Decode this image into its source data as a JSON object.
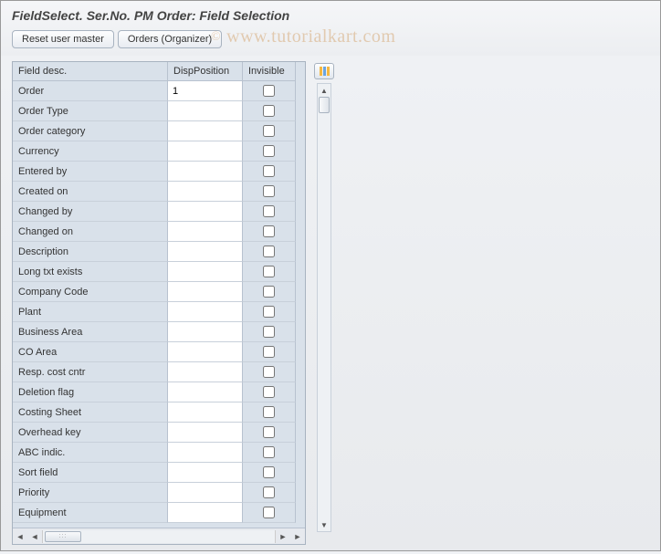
{
  "header": {
    "title": "FieldSelect. Ser.No. PM Order: Field Selection"
  },
  "toolbar": {
    "reset_label": "Reset user master",
    "orders_label": "Orders (Organizer)"
  },
  "table": {
    "columns": {
      "field_desc": "Field desc.",
      "disp_position": "DispPosition",
      "invisible": "Invisible"
    },
    "rows": [
      {
        "label": "Order",
        "position": "1",
        "invisible": false
      },
      {
        "label": "Order Type",
        "position": "",
        "invisible": false
      },
      {
        "label": "Order category",
        "position": "",
        "invisible": false
      },
      {
        "label": "Currency",
        "position": "",
        "invisible": false
      },
      {
        "label": "Entered by",
        "position": "",
        "invisible": false
      },
      {
        "label": "Created on",
        "position": "",
        "invisible": false
      },
      {
        "label": "Changed by",
        "position": "",
        "invisible": false
      },
      {
        "label": "Changed on",
        "position": "",
        "invisible": false
      },
      {
        "label": "Description",
        "position": "",
        "invisible": false
      },
      {
        "label": "Long txt exists",
        "position": "",
        "invisible": false
      },
      {
        "label": "Company Code",
        "position": "",
        "invisible": false
      },
      {
        "label": "Plant",
        "position": "",
        "invisible": false
      },
      {
        "label": "Business Area",
        "position": "",
        "invisible": false
      },
      {
        "label": "CO Area",
        "position": "",
        "invisible": false
      },
      {
        "label": "Resp. cost cntr",
        "position": "",
        "invisible": false
      },
      {
        "label": "Deletion flag",
        "position": "",
        "invisible": false
      },
      {
        "label": "Costing Sheet",
        "position": "",
        "invisible": false
      },
      {
        "label": "Overhead key",
        "position": "",
        "invisible": false
      },
      {
        "label": "ABC indic.",
        "position": "",
        "invisible": false
      },
      {
        "label": "Sort field",
        "position": "",
        "invisible": false
      },
      {
        "label": "Priority",
        "position": "",
        "invisible": false
      },
      {
        "label": "Equipment",
        "position": "",
        "invisible": false
      }
    ]
  },
  "watermark": "www.tutorialkart.com"
}
